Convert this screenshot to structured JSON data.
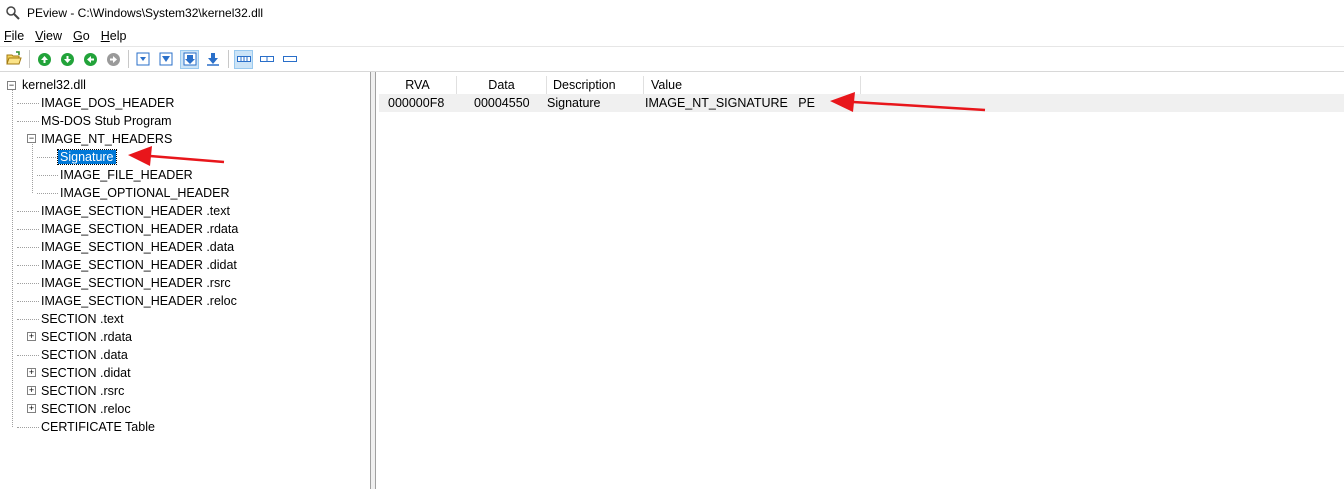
{
  "window": {
    "title": "PEview - C:\\Windows\\System32\\kernel32.dll"
  },
  "menu": [
    {
      "accel": "F",
      "rest": "ile"
    },
    {
      "accel": "V",
      "rest": "iew"
    },
    {
      "accel": "G",
      "rest": "o"
    },
    {
      "accel": "H",
      "rest": "elp"
    }
  ],
  "tree": {
    "root": "kernel32.dll",
    "items": [
      {
        "label": "IMAGE_DOS_HEADER"
      },
      {
        "label": "MS-DOS Stub Program"
      },
      {
        "label": "IMAGE_NT_HEADERS"
      },
      {
        "label": "Signature"
      },
      {
        "label": "IMAGE_FILE_HEADER"
      },
      {
        "label": "IMAGE_OPTIONAL_HEADER"
      },
      {
        "label": "IMAGE_SECTION_HEADER .text"
      },
      {
        "label": "IMAGE_SECTION_HEADER .rdata"
      },
      {
        "label": "IMAGE_SECTION_HEADER .data"
      },
      {
        "label": "IMAGE_SECTION_HEADER .didat"
      },
      {
        "label": "IMAGE_SECTION_HEADER .rsrc"
      },
      {
        "label": "IMAGE_SECTION_HEADER .reloc"
      },
      {
        "label": "SECTION .text"
      },
      {
        "label": "SECTION .rdata"
      },
      {
        "label": "SECTION .data"
      },
      {
        "label": "SECTION .didat"
      },
      {
        "label": "SECTION .rsrc"
      },
      {
        "label": "SECTION .reloc"
      },
      {
        "label": "CERTIFICATE Table"
      }
    ]
  },
  "list": {
    "columns": [
      "RVA",
      "Data",
      "Description",
      "Value"
    ],
    "rows": [
      {
        "rva": "000000F8",
        "data": "00004550",
        "description": "Signature",
        "value": "IMAGE_NT_SIGNATURE   PE"
      }
    ]
  },
  "colors": {
    "selection": "#0078d7",
    "annotation_arrow": "#e8161b",
    "toolbar_green": "#22a33a",
    "toolbar_blue": "#2a6fc9"
  },
  "icons": {
    "title": "magnifier-icon",
    "open": "open-folder-icon",
    "nav": [
      "green-up-arrow-icon",
      "green-down-arrow-icon",
      "green-back-arrow-icon",
      "gray-forward-arrow-icon"
    ],
    "view": [
      "view-hex-icon",
      "view-raw-icon",
      "view-pressed-icon",
      "view-download-icon"
    ],
    "layout": [
      "layout-icon-1",
      "layout-icon-2",
      "layout-icon-3"
    ]
  }
}
